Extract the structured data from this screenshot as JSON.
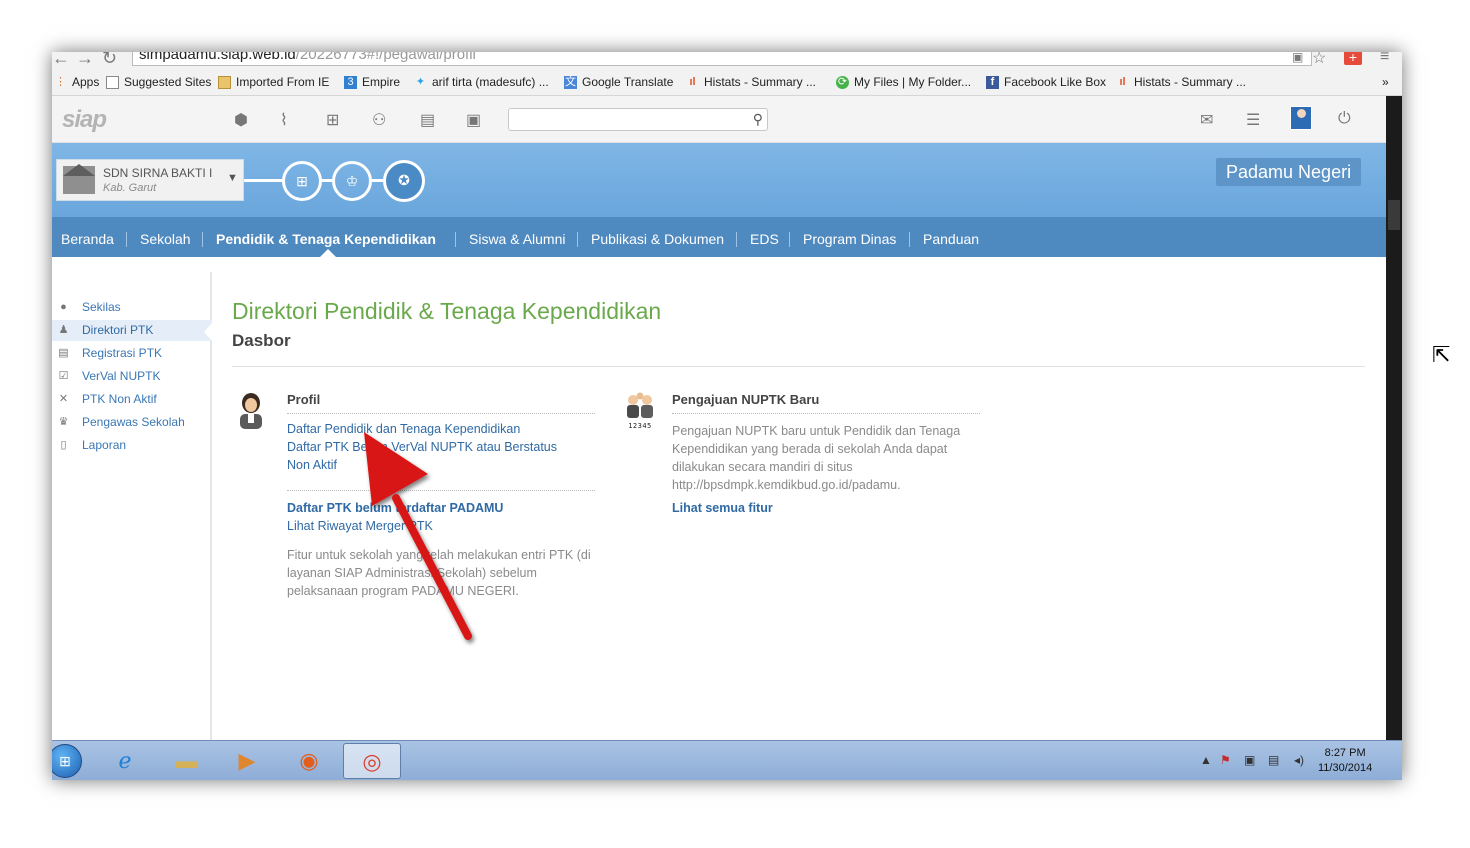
{
  "browser": {
    "url_host": "simpadamu.siap.web.id",
    "url_path": "/20226773#!/pegawai/profil",
    "bookmarks": [
      {
        "label": "Apps",
        "icon": "apps-icon"
      },
      {
        "label": "Suggested Sites",
        "icon": "page-icon"
      },
      {
        "label": "Imported From IE",
        "icon": "folder-icon"
      },
      {
        "label": "Empire",
        "icon": "empire-icon"
      },
      {
        "label": "arif tirta (madesufc) ...",
        "icon": "twitter-icon"
      },
      {
        "label": "Google Translate",
        "icon": "translate-icon"
      },
      {
        "label": "Histats - Summary ...",
        "icon": "histats-icon"
      },
      {
        "label": "My Files | My Folder...",
        "icon": "myfiles-icon"
      },
      {
        "label": "Facebook Like Box",
        "icon": "facebook-icon"
      },
      {
        "label": "Histats - Summary ...",
        "icon": "histats-icon"
      }
    ],
    "overflow": "»"
  },
  "site": {
    "logo": "siap",
    "school": {
      "name": "SDN SIRNA BAKTI I",
      "city": "Kab. Garut"
    },
    "brand": "Padamu Negeri",
    "menu": [
      {
        "label": "Beranda",
        "active": false
      },
      {
        "label": "Sekolah",
        "active": false
      },
      {
        "label": "Pendidik & Tenaga Kependidikan",
        "active": true
      },
      {
        "label": "Siswa & Alumni",
        "active": false
      },
      {
        "label": "Publikasi & Dokumen",
        "active": false
      },
      {
        "label": "EDS",
        "active": false
      },
      {
        "label": "Program Dinas",
        "active": false
      },
      {
        "label": "Panduan",
        "active": false
      }
    ]
  },
  "sidebar": {
    "items": [
      {
        "label": "Sekilas",
        "icon": "info-icon"
      },
      {
        "label": "Direktori PTK",
        "icon": "person-icon",
        "active": true
      },
      {
        "label": "Registrasi PTK",
        "icon": "id-card-icon"
      },
      {
        "label": "VerVal NUPTK",
        "icon": "clipboard-check-icon"
      },
      {
        "label": "PTK Non Aktif",
        "icon": "x-icon"
      },
      {
        "label": "Pengawas Sekolah",
        "icon": "crown-icon"
      },
      {
        "label": "Laporan",
        "icon": "document-icon"
      }
    ]
  },
  "main": {
    "title": "Direktori Pendidik & Tenaga Kependidikan",
    "subtitle": "Dasbor",
    "profil": {
      "heading": "Profil",
      "link1": "Daftar Pendidik dan Tenaga Kependidikan",
      "link2a": "Daftar PTK Belum VerVal NUPTK atau Berstatus",
      "link2b": "Non Aktif",
      "link3": "Daftar PTK belum terdaftar PADAMU",
      "link4": "Lihat Riwayat Merger PTK",
      "desc": "Fitur untuk sekolah yang telah melakukan entri PTK (di layanan SIAP Administrasi Sekolah) sebelum pelaksanaan program PADAMU NEGERI."
    },
    "nuptk": {
      "heading": "Pengajuan NUPTK Baru",
      "desc": "Pengajuan NUPTK baru untuk Pendidik dan Tenaga Kependidikan yang berada di sekolah Anda dapat dilakukan secara mandiri di situs http://bpsdmpk.kemdikbud.go.id/padamu.",
      "link": "Lihat semua fitur",
      "icon_number": "12345"
    }
  },
  "taskbar": {
    "time": "8:27 PM",
    "date": "11/30/2014"
  },
  "colors": {
    "accent": "#6aa94b",
    "menu": "#4e89c0",
    "band": "#7fb6e6",
    "arrow": "#d81818"
  }
}
